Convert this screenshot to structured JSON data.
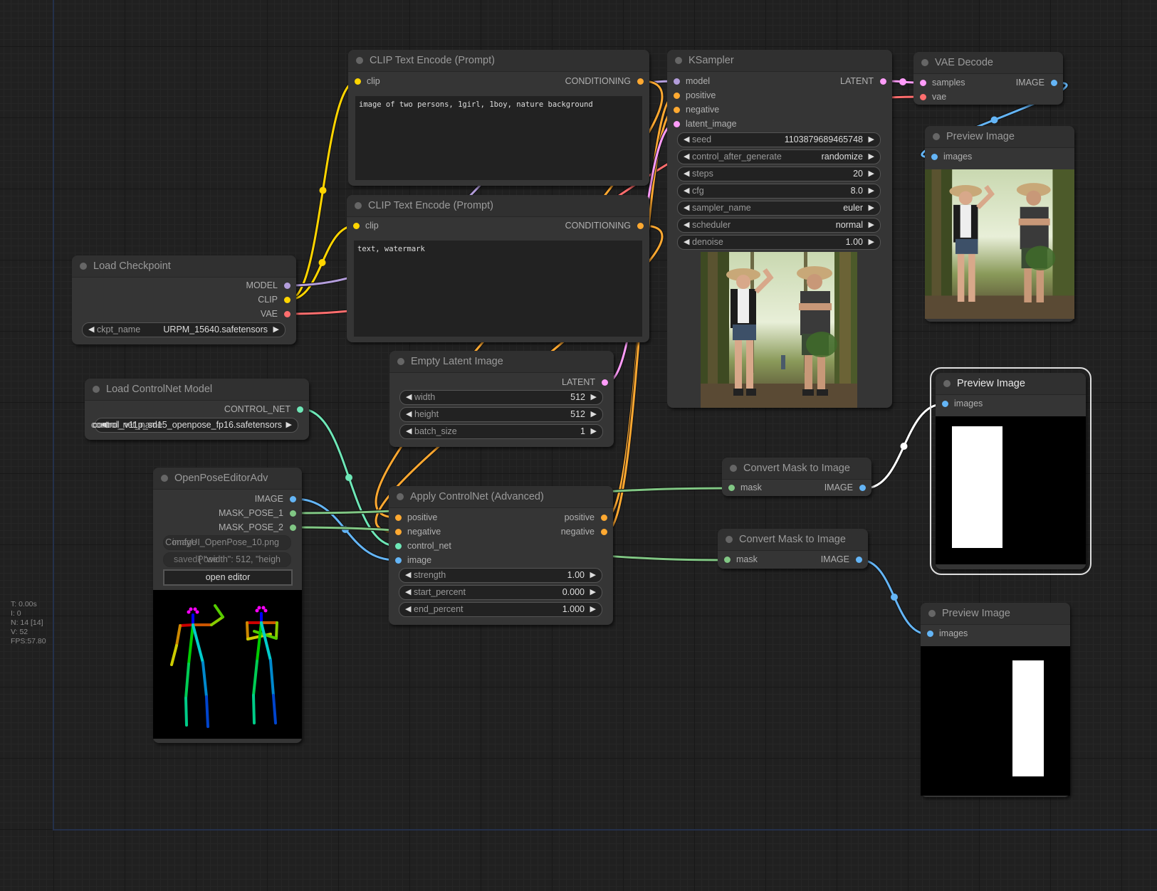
{
  "colors": {
    "model": "#b39ddb",
    "clip": "#ffd500",
    "vae": "#ff6e6e",
    "conditioning": "#ffa931",
    "latent": "#ff9cf9",
    "image": "#64b5f6",
    "mask": "#81c784",
    "control_net": "#6ee7b7",
    "selected_link": "#ffffff"
  },
  "stats": {
    "time": "T: 0.00s",
    "iterations": "I: 0",
    "nodes": "N: 14 [14]",
    "visible": "V: 52",
    "fps": "FPS:57.80"
  },
  "nodes": {
    "clip_pos": {
      "title": "CLIP Text Encode (Prompt)",
      "input_clip": "clip",
      "output": "CONDITIONING",
      "text": "image of two persons, 1girl, 1boy, nature background"
    },
    "clip_neg": {
      "title": "CLIP Text Encode (Prompt)",
      "input_clip": "clip",
      "output": "CONDITIONING",
      "text": "text, watermark"
    },
    "ksampler": {
      "title": "KSampler",
      "inputs": [
        "model",
        "positive",
        "negative",
        "latent_image"
      ],
      "output": "LATENT",
      "widgets": [
        {
          "name": "seed",
          "value": "1103879689465748"
        },
        {
          "name": "control_after_generate",
          "value": "randomize"
        },
        {
          "name": "steps",
          "value": "20"
        },
        {
          "name": "cfg",
          "value": "8.0"
        },
        {
          "name": "sampler_name",
          "value": "euler"
        },
        {
          "name": "scheduler",
          "value": "normal"
        },
        {
          "name": "denoise",
          "value": "1.00"
        }
      ],
      "preview_alt": "Two persons in hats standing in a forest"
    },
    "vae_decode": {
      "title": "VAE Decode",
      "inputs": [
        "samples",
        "vae"
      ],
      "output": "IMAGE"
    },
    "preview1": {
      "title": "Preview Image",
      "input": "images",
      "preview_alt": "Generated forest image of girl and boy"
    },
    "load_checkpoint": {
      "title": "Load Checkpoint",
      "outputs": [
        "MODEL",
        "CLIP",
        "VAE"
      ],
      "widget": {
        "name": "ckpt_name",
        "value": "URPM_15640.safetensors"
      }
    },
    "load_controlnet": {
      "title": "Load ControlNet Model",
      "output": "CONTROL_NET",
      "widget": {
        "name": "control_net_name",
        "value": "control_v11p_sd15_openpose_fp16.safetensors"
      }
    },
    "openpose": {
      "title": "OpenPoseEditorAdv",
      "outputs": [
        "IMAGE",
        "MASK_POSE_1",
        "MASK_POSE_2"
      ],
      "widget_image": {
        "name": "image",
        "value": "ComfyUI_OpenPose_10.png"
      },
      "widget_saved": {
        "name": "savedPose",
        "value": "{ \"width\": 512,     \"heigh"
      },
      "button": "open editor"
    },
    "empty_latent": {
      "title": "Empty Latent Image",
      "output": "LATENT",
      "widgets": [
        {
          "name": "width",
          "value": "512"
        },
        {
          "name": "height",
          "value": "512"
        },
        {
          "name": "batch_size",
          "value": "1"
        }
      ]
    },
    "apply_controlnet": {
      "title": "Apply ControlNet (Advanced)",
      "inputs": [
        "positive",
        "negative",
        "control_net",
        "image"
      ],
      "outputs": [
        "positive",
        "negative"
      ],
      "widgets": [
        {
          "name": "strength",
          "value": "1.00"
        },
        {
          "name": "start_percent",
          "value": "0.000"
        },
        {
          "name": "end_percent",
          "value": "1.000"
        }
      ]
    },
    "convert_mask1": {
      "title": "Convert Mask to Image",
      "input": "mask",
      "output": "IMAGE"
    },
    "convert_mask2": {
      "title": "Convert Mask to Image",
      "input": "mask",
      "output": "IMAGE"
    },
    "preview2": {
      "title": "Preview Image",
      "input": "images",
      "preview_alt": "Mask pose 1: white rectangle on left"
    },
    "preview3": {
      "title": "Preview Image",
      "input": "images",
      "preview_alt": "Mask pose 2: white rectangle on right"
    }
  }
}
